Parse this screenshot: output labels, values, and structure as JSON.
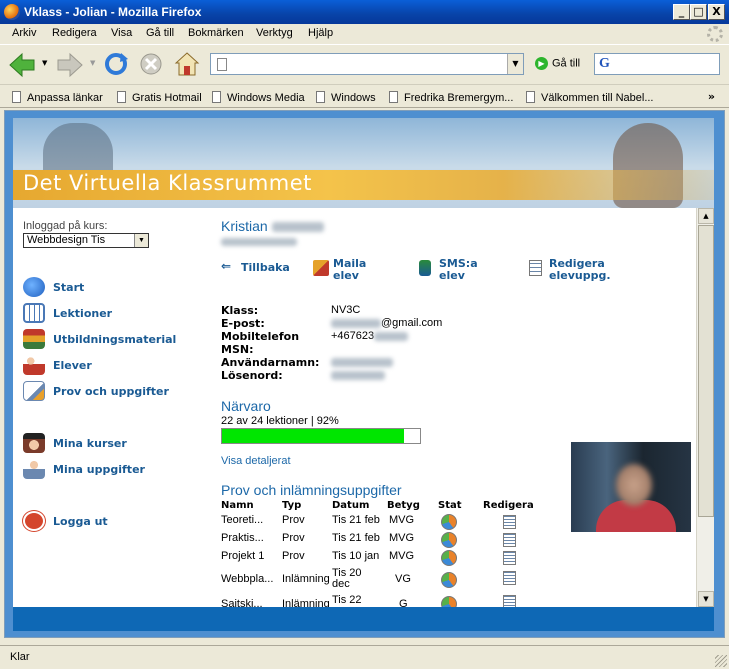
{
  "window": {
    "title": "Vklass - Jolian - Mozilla Firefox",
    "minimize": "_",
    "maximize": "□",
    "close": "X"
  },
  "menu": [
    "Arkiv",
    "Redigera",
    "Visa",
    "Gå till",
    "Bokmärken",
    "Verktyg",
    "Hjälp"
  ],
  "toolbar": {
    "url": "",
    "go_label": "Gå till",
    "search_value": ""
  },
  "bookmarks": [
    "Anpassa länkar",
    "Gratis Hotmail",
    "Windows Media",
    "Windows",
    "Fredrika Bremergym...",
    "Välkommen till Nabel..."
  ],
  "bookmarks_more": "»",
  "banner": {
    "title": "Det Virtuella Klassrummet"
  },
  "sidebar": {
    "course_label": "Inloggad på kurs:",
    "course_value": "Webbdesign Tis",
    "items": [
      {
        "label": "Start",
        "icon": "globe-icon",
        "color": "#1f5fbf"
      },
      {
        "label": "Lektioner",
        "icon": "calendar-icon",
        "color": "#4a78b6"
      },
      {
        "label": "Utbildningsmaterial",
        "icon": "books-icon",
        "color": "#c07a2a"
      },
      {
        "label": "Elever",
        "icon": "students-icon",
        "color": "#c0392b"
      },
      {
        "label": "Prov och uppgifter",
        "icon": "test-icon",
        "color": "#6b88b0"
      },
      {
        "label": "Mina kurser",
        "icon": "graduate-icon",
        "color": "#7a3b2a"
      },
      {
        "label": "Mina uppgifter",
        "icon": "my-tasks-icon",
        "color": "#b04a3a"
      },
      {
        "label": "Logga ut",
        "icon": "logout-hand-icon",
        "color": "#d4452c"
      }
    ]
  },
  "student": {
    "first_name": "Kristian"
  },
  "actions": [
    {
      "label": "Tillbaka",
      "icon": "back-arrow-icon"
    },
    {
      "label": "Maila elev",
      "icon": "mail-icon"
    },
    {
      "label": "SMS:a elev",
      "icon": "phone-icon"
    },
    {
      "label": "Redigera elevuppg.",
      "icon": "edit-document-icon"
    }
  ],
  "info": [
    {
      "key": "Klass:",
      "value": "NV3C",
      "blur_prefix": false
    },
    {
      "key": "E-post:",
      "value": "@gmail.com",
      "blur_prefix": true
    },
    {
      "key": "Mobiltelefon",
      "value": "+467623",
      "blur_suffix": true
    },
    {
      "key": "MSN:",
      "value": ""
    },
    {
      "key": "Användarnamn:",
      "value": "",
      "blurred": true
    },
    {
      "key": "Lösenord:",
      "value": "",
      "blurred": true
    }
  ],
  "attendance": {
    "title": "Närvaro",
    "text": "22 av 24 lektioner | 92%",
    "percent": 92,
    "detail_link": "Visa detaljerat"
  },
  "tasks": {
    "title": "Prov och inlämningsuppgifter",
    "headers": [
      "Namn",
      "Typ",
      "Datum",
      "Betyg",
      "Stat",
      "Redigera"
    ],
    "rows": [
      {
        "name": "Teoreti...",
        "type": "Prov",
        "date": "Tis 21 feb",
        "grade": "MVG"
      },
      {
        "name": "Praktis...",
        "type": "Prov",
        "date": "Tis 21 feb",
        "grade": "MVG"
      },
      {
        "name": "Projekt 1",
        "type": "Prov",
        "date": "Tis 10 jan",
        "grade": "MVG"
      },
      {
        "name": "Webbpla...",
        "type": "Inlämning",
        "date": "Tis 20 dec",
        "grade": "VG"
      },
      {
        "name": "Saitski...",
        "type": "Inlämning",
        "date": "Tis 22",
        "grade": "G"
      }
    ]
  },
  "status": {
    "text": "Klar"
  }
}
